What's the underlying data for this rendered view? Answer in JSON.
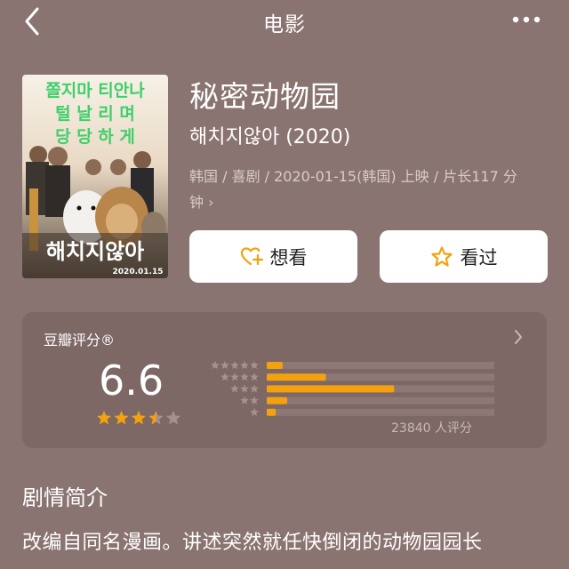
{
  "nav": {
    "title": "电影"
  },
  "movie": {
    "title": "秘密动物园",
    "original_title": "해치지않아 (2020)",
    "meta_line1": "韩国 / 喜剧 / 2020-01-15(韩国) 上映 / 片长117 分",
    "meta_line2": "钟 ›",
    "poster_lines": [
      "쫄지마 티안나",
      "털 날 리 며",
      "당 당 하 게"
    ],
    "poster_logo": "해치지않아",
    "poster_date": "2020.01.15"
  },
  "actions": {
    "want": "想看",
    "seen": "看过"
  },
  "rating": {
    "label": "豆瓣评分®",
    "score": "6.6",
    "stars_value": 3.5,
    "distribution": [
      {
        "stars": 5,
        "percent": 7
      },
      {
        "stars": 4,
        "percent": 26
      },
      {
        "stars": 3,
        "percent": 56
      },
      {
        "stars": 2,
        "percent": 9
      },
      {
        "stars": 1,
        "percent": 4
      }
    ],
    "total": "23840 人评分"
  },
  "synopsis": {
    "heading": "剧情简介",
    "text": "改编自同名漫画。讲述突然就任快倒闭的动物园园长"
  },
  "colors": {
    "accent": "#f4a10d",
    "background": "#8a7471",
    "card": "#7d6866"
  }
}
